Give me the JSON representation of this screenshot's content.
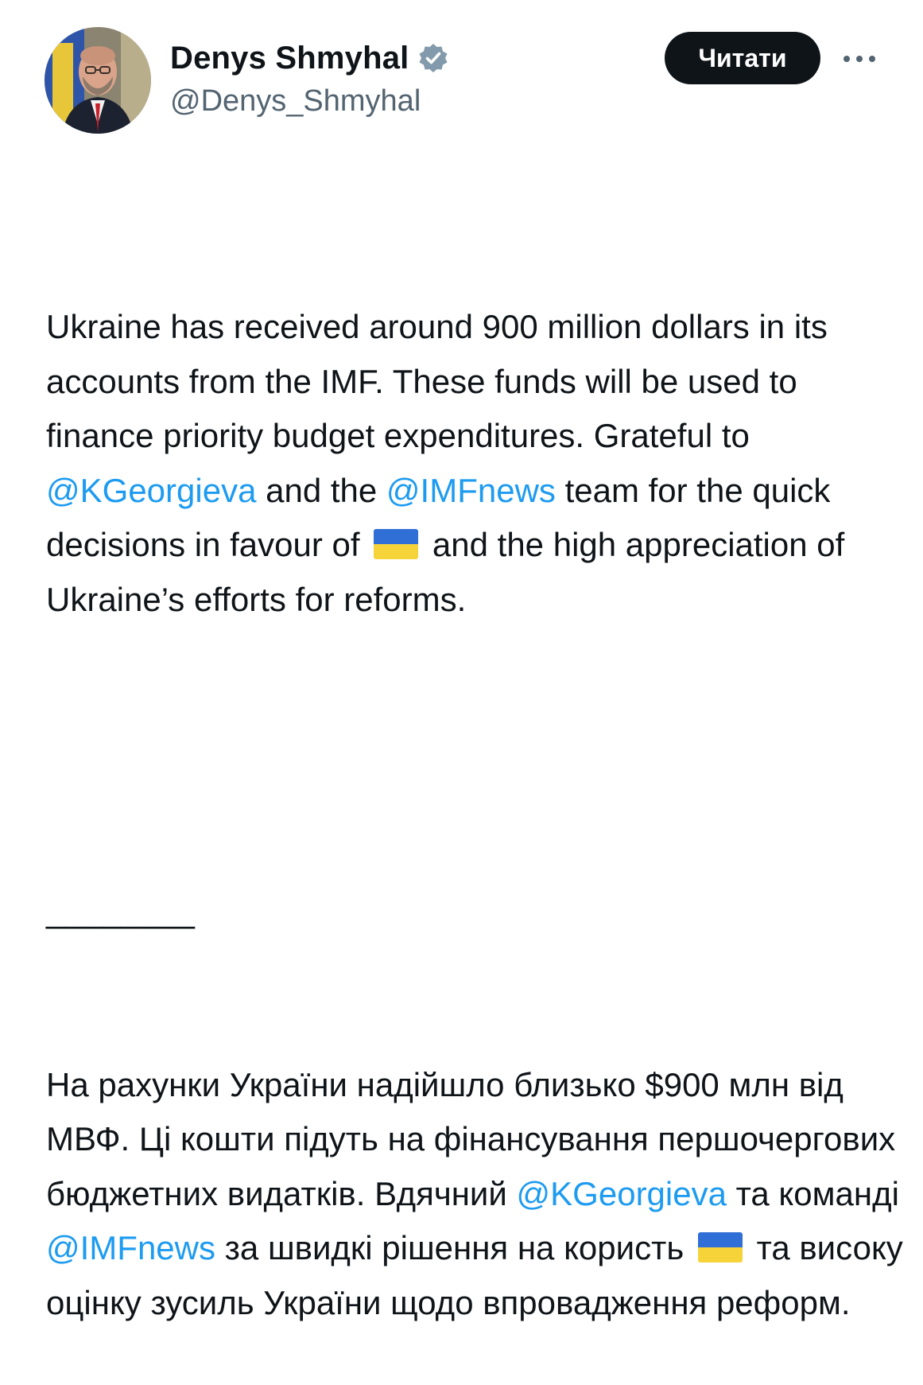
{
  "author": {
    "display_name": "Denys Shmyhal",
    "handle": "@Denys_Shmyhal",
    "verified_icon": "verified-badge-icon",
    "avatar_icon": "avatar-photo"
  },
  "follow_button": {
    "label": "Читати"
  },
  "more_button": {
    "icon": "more-horizontal-icon"
  },
  "tweet": {
    "en": {
      "part1": "Ukraine has received around 900 million dollars in its accounts from the IMF. These funds will be used to finance priority budget expenditures. Grateful to ",
      "mention1": "@KGeorgieva",
      "part2": " and the ",
      "mention2": "@IMFnews",
      "part3": " team for the quick decisions in favour of",
      "part4": "and the high appreciation of Ukraine’s efforts for reforms."
    },
    "separator": "________",
    "ua": {
      "part1": "На рахунки України надійшло близько $900 млн від МВФ. Ці кошти підуть на фінансування першочергових бюджетних видатків. Вдячний ",
      "mention1": "@KGeorgieva",
      "part2": " та команді ",
      "mention2": "@IMFnews",
      "part3": " за швидкі рішення на користь",
      "part4": "та високу оцінку зусиль України щодо впровадження реформ."
    }
  },
  "colors": {
    "text": "#0f1419",
    "secondary": "#536471",
    "link": "#1d9bf0",
    "verified": "#829aab",
    "flag_blue": "#2f6fd6",
    "flag_yellow": "#f7d33a"
  }
}
